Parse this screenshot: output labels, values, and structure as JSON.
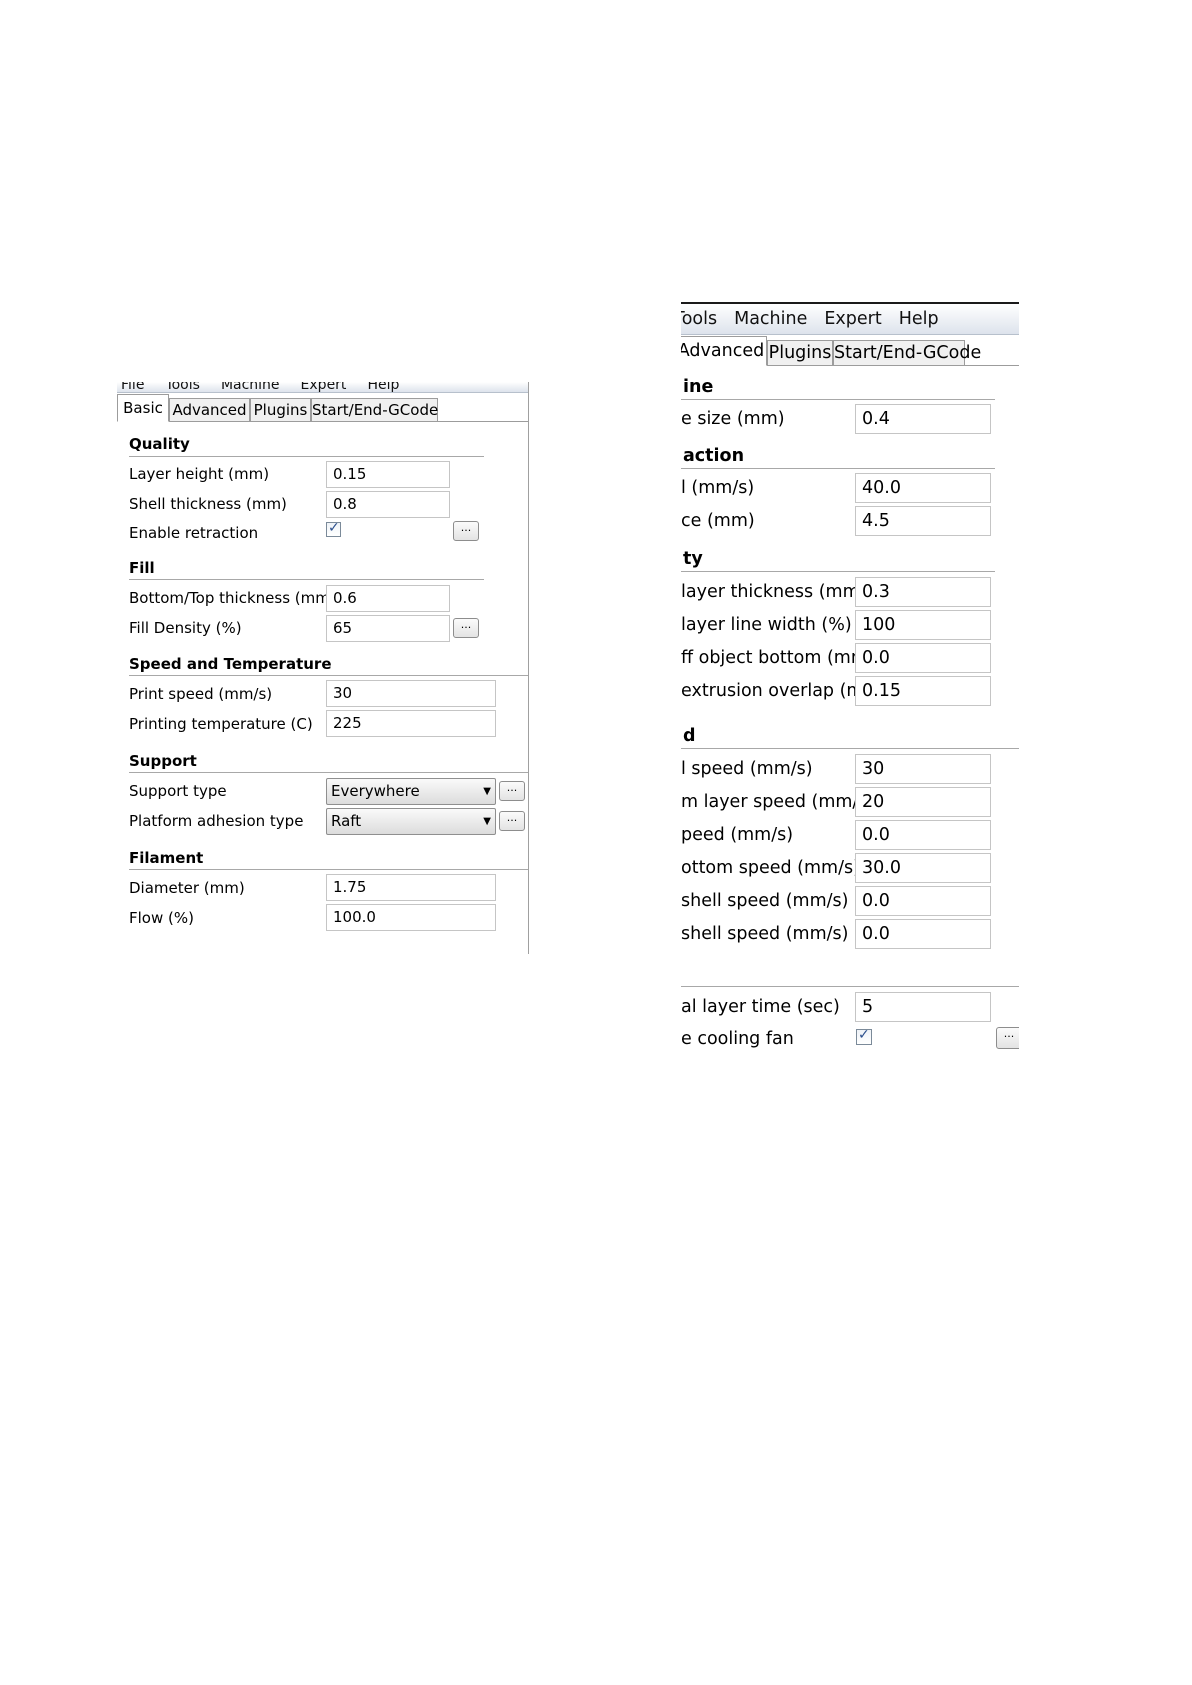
{
  "left": {
    "menu": [
      "File",
      "Tools",
      "Machine",
      "Expert",
      "Help"
    ],
    "tabs": [
      "Basic",
      "Advanced",
      "Plugins",
      "Start/End-GCode"
    ],
    "active_tab": "Basic",
    "sections": {
      "quality": "Quality",
      "fill": "Fill",
      "speed": "Speed and Temperature",
      "support": "Support",
      "filament": "Filament"
    },
    "fields": {
      "layer_height": {
        "label": "Layer height (mm)",
        "value": "0.15"
      },
      "shell_thickness": {
        "label": "Shell thickness (mm)",
        "value": "0.8"
      },
      "enable_retraction": {
        "label": "Enable retraction",
        "checked": true
      },
      "bottom_top_thickness": {
        "label": "Bottom/Top thickness (mm)",
        "value": "0.6"
      },
      "fill_density": {
        "label": "Fill Density (%)",
        "value": "65"
      },
      "print_speed": {
        "label": "Print speed (mm/s)",
        "value": "30"
      },
      "printing_temperature": {
        "label": "Printing temperature (C)",
        "value": "225"
      },
      "support_type": {
        "label": "Support type",
        "value": "Everywhere"
      },
      "platform_adhesion": {
        "label": "Platform adhesion type",
        "value": "Raft"
      },
      "diameter": {
        "label": "Diameter (mm)",
        "value": "1.75"
      },
      "flow": {
        "label": "Flow (%)",
        "value": "100.0"
      }
    },
    "dots_label": "..."
  },
  "right": {
    "menu": [
      "Tools",
      "Machine",
      "Expert",
      "Help"
    ],
    "tabs": [
      "Advanced",
      "Plugins",
      "Start/End-GCode"
    ],
    "active_tab": "Advanced",
    "sections": {
      "machine": "ine",
      "retraction": "action",
      "quality": "ty",
      "speed": "d",
      "cool": ""
    },
    "fields": {
      "nozzle_size": {
        "label": "e size (mm)",
        "value": "0.4"
      },
      "retraction_speed": {
        "label": "l (mm/s)",
        "value": "40.0"
      },
      "retraction_distance": {
        "label": "ce (mm)",
        "value": "4.5"
      },
      "initial_layer_thickness": {
        "label": "layer thickness (mm)",
        "value": "0.3"
      },
      "initial_layer_line_width": {
        "label": "layer line width (%)",
        "value": "100"
      },
      "cut_off_object_bottom": {
        "label": "ff object bottom (mm)",
        "value": "0.0"
      },
      "dual_extrusion_overlap": {
        "label": "extrusion overlap (mm)",
        "value": "0.15"
      },
      "travel_speed": {
        "label": "l speed (mm/s)",
        "value": "30"
      },
      "bottom_layer_speed": {
        "label": "m layer speed (mm/s)",
        "value": "20"
      },
      "infill_speed": {
        "label": "peed (mm/s)",
        "value": "0.0"
      },
      "top_bottom_speed": {
        "label": "ottom speed (mm/s)",
        "value": "30.0"
      },
      "outer_shell_speed": {
        "label": "shell speed (mm/s)",
        "value": "0.0"
      },
      "inner_shell_speed": {
        "label": "shell speed (mm/s)",
        "value": "0.0"
      },
      "minimal_layer_time": {
        "label": "al layer time (sec)",
        "value": "5"
      },
      "enable_cooling_fan": {
        "label": "e cooling fan",
        "checked": true
      }
    },
    "dots_label": "..."
  }
}
